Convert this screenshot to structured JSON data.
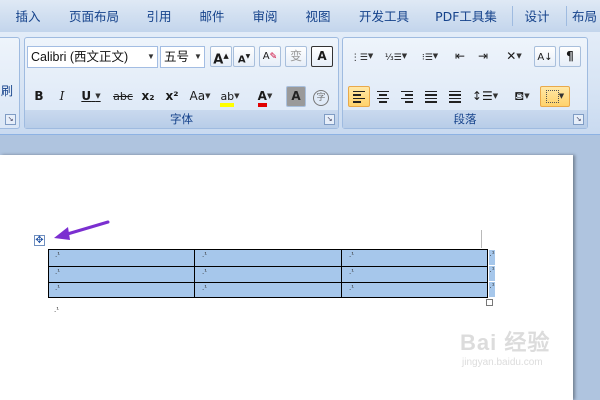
{
  "tabs": [
    {
      "label": "插入"
    },
    {
      "label": "页面布局"
    },
    {
      "label": "引用"
    },
    {
      "label": "邮件"
    },
    {
      "label": "审阅"
    },
    {
      "label": "视图"
    },
    {
      "label": "开发工具"
    },
    {
      "label": "PDF工具集"
    },
    {
      "label": "设计"
    },
    {
      "label": "布局"
    }
  ],
  "clipboard": {
    "partial_label": "刷"
  },
  "font_group": {
    "label": "字体",
    "font_name": "Calibri (西文正文)",
    "font_size": "五号",
    "grow_font": "A",
    "shrink_font": "A",
    "clear_format": "A",
    "phonetic_guide": "变",
    "char_border": "A",
    "bold": "B",
    "italic": "I",
    "underline": "U",
    "strikethrough": "abc",
    "subscript": "x₂",
    "superscript": "x²",
    "change_case": "Aa",
    "highlight": "ab",
    "font_color": "A",
    "char_shading": "A",
    "enclose_char": "字"
  },
  "paragraph_group": {
    "label": "段落"
  },
  "watermark": {
    "brand": "Bai 经验",
    "url": "jingyan.baidu.com"
  },
  "colors": {
    "table_selection": "#a6c7eb",
    "arrow": "#7b2fd0",
    "highlight_yellow": "#ffff00",
    "font_red": "#e00000"
  }
}
